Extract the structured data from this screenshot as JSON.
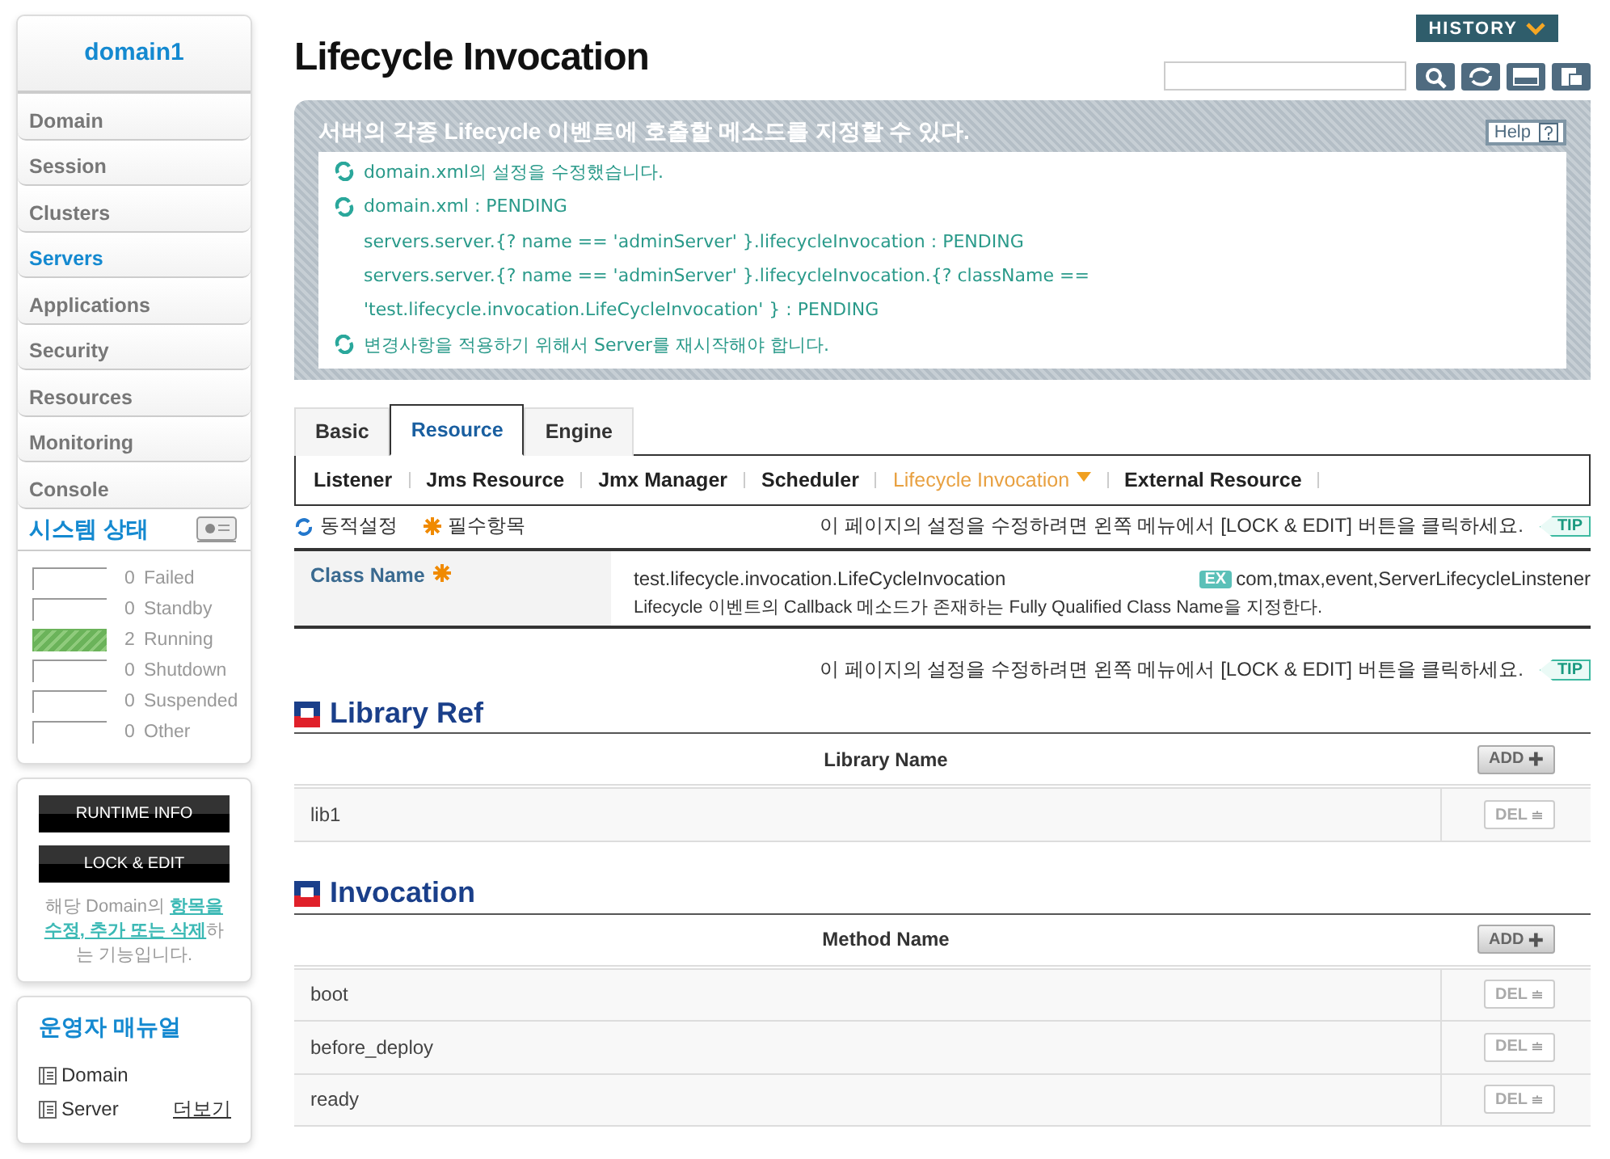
{
  "sidebar": {
    "domain": "domain1",
    "menu": [
      {
        "label": "Domain",
        "selected": false
      },
      {
        "label": "Session",
        "selected": false
      },
      {
        "label": "Clusters",
        "selected": false
      },
      {
        "label": "Servers",
        "selected": true
      },
      {
        "label": "Applications",
        "selected": false
      },
      {
        "label": "Security",
        "selected": false
      },
      {
        "label": "Resources",
        "selected": false
      },
      {
        "label": "Monitoring",
        "selected": false
      },
      {
        "label": "Console",
        "selected": false
      }
    ],
    "system_status": {
      "title": "시스템 상태",
      "rows": [
        {
          "count": "0",
          "label": "Failed",
          "active": false
        },
        {
          "count": "0",
          "label": "Standby",
          "active": false
        },
        {
          "count": "2",
          "label": "Running",
          "active": true
        },
        {
          "count": "0",
          "label": "Shutdown",
          "active": false
        },
        {
          "count": "0",
          "label": "Suspended",
          "active": false
        },
        {
          "count": "0",
          "label": "Other",
          "active": false
        }
      ]
    },
    "buttons": [
      "RUNTIME INFO",
      "LOCK & EDIT"
    ],
    "note": "해당 Domain의 **항목을 수정, 추가 또는 삭제**하는 기능입니다.",
    "manual": {
      "title": "운영자 매뉴얼",
      "items": [
        "Domain",
        "Server"
      ],
      "more": "더보기"
    }
  },
  "header": {
    "title": "Lifecycle Invocation",
    "history": "HISTORY"
  },
  "info": {
    "title": "서버의 각종 Lifecycle 이벤트에 호출할 메소드를 지정할 수 있다.",
    "help": "Help",
    "messages": [
      {
        "kind": "status",
        "text": "domain.xml의 설정을 수정했습니다."
      },
      {
        "kind": "status",
        "text": "domain.xml : PENDING"
      },
      {
        "kind": "detail",
        "text": "servers.server.{? name == 'adminServer' }.lifecycleInvocation : PENDING"
      },
      {
        "kind": "detail",
        "text": "servers.server.{? name == 'adminServer' }.lifecycleInvocation.{? className =="
      },
      {
        "kind": "detail",
        "text": "'test.lifecycle.invocation.LifeCycleInvocation' } : PENDING"
      },
      {
        "kind": "status",
        "text": "변경사항을 적용하기 위해서 Server를 재시작해야 합니다."
      }
    ]
  },
  "tabs": [
    {
      "label": "Basic",
      "selected": false
    },
    {
      "label": "Resource",
      "selected": true
    },
    {
      "label": "Engine",
      "selected": false
    }
  ],
  "subtabs": [
    {
      "label": "Listener",
      "selected": false
    },
    {
      "label": "Jms Resource",
      "selected": false
    },
    {
      "label": "Jmx Manager",
      "selected": false
    },
    {
      "label": "Scheduler",
      "selected": false
    },
    {
      "label": "Lifecycle Invocation",
      "selected": true
    },
    {
      "label": "External Resource",
      "selected": false
    }
  ],
  "legend": {
    "dynamic": "동적설정",
    "required": "필수항목",
    "tip_text": "이 페이지의 설정을 수정하려면 왼쪽 메뉴에서 [LOCK & EDIT] 버튼을 클릭하세요.",
    "tip": "TIP"
  },
  "form": {
    "label": "Class Name",
    "required": true,
    "value": "test.lifecycle.invocation.LifeCycleInvocation",
    "example_badge": "EX",
    "example": "com,tmax,event,ServerLifecycleLinstener",
    "description": "Lifecycle 이벤트의 Callback 메소드가 존재하는 Fully Qualified Class Name을 지정한다."
  },
  "tip2": {
    "text": "이 페이지의 설정을 수정하려면 왼쪽 메뉴에서 [LOCK & EDIT] 버튼을 클릭하세요.",
    "tip": "TIP"
  },
  "sections": [
    {
      "title": "Library Ref",
      "column": "Library Name",
      "add": {
        "label": "ADD",
        "disabled": true
      },
      "rows": [
        {
          "name": "lib1",
          "delete": {
            "label": "DEL",
            "disabled": true
          }
        }
      ]
    },
    {
      "title": "Invocation",
      "column": "Method Name",
      "add": {
        "label": "ADD",
        "disabled": true
      },
      "rows": [
        {
          "name": "boot",
          "delete": {
            "label": "DEL",
            "disabled": true
          }
        },
        {
          "name": "before_deploy",
          "delete": {
            "label": "DEL",
            "disabled": true
          }
        },
        {
          "name": "ready",
          "delete": {
            "label": "DEL",
            "disabled": true
          }
        }
      ]
    }
  ]
}
